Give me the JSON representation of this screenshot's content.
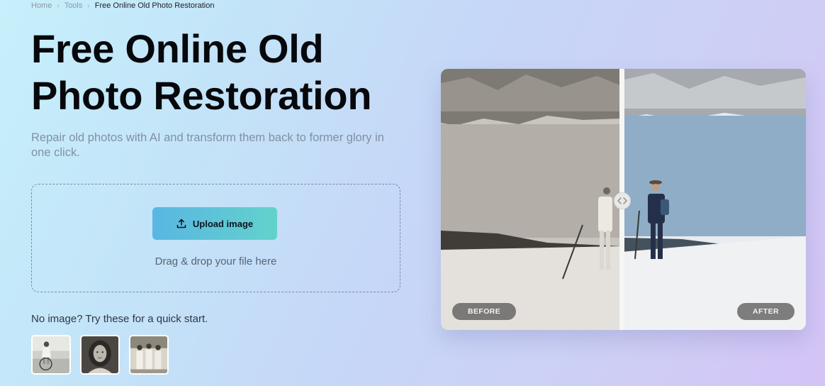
{
  "breadcrumb": {
    "items": [
      "Home",
      "Tools"
    ],
    "current": "Free Online Old Photo Restoration"
  },
  "hero": {
    "title": "Free Online Old Photo Restoration",
    "subtitle": "Repair old photos with AI and transform them back to former glory in one click."
  },
  "upload": {
    "button_label": "Upload image",
    "drop_hint": "Drag & drop your file here"
  },
  "samples": {
    "label": "No image? Try these for a quick start.",
    "items": [
      "sample-photo-child-with-hoop",
      "sample-photo-girl-portrait",
      "sample-photo-group-women"
    ]
  },
  "comparison": {
    "before_label": "BEFORE",
    "after_label": "AFTER",
    "slider_position": 0.5
  },
  "icons": {
    "upload": "upload-icon",
    "handle": "compare-handle-icon",
    "chevron": "chevron-right-icon"
  },
  "colors": {
    "button_start": "#5ab6e2",
    "button_end": "#62d2cc",
    "title": "#07080c"
  }
}
